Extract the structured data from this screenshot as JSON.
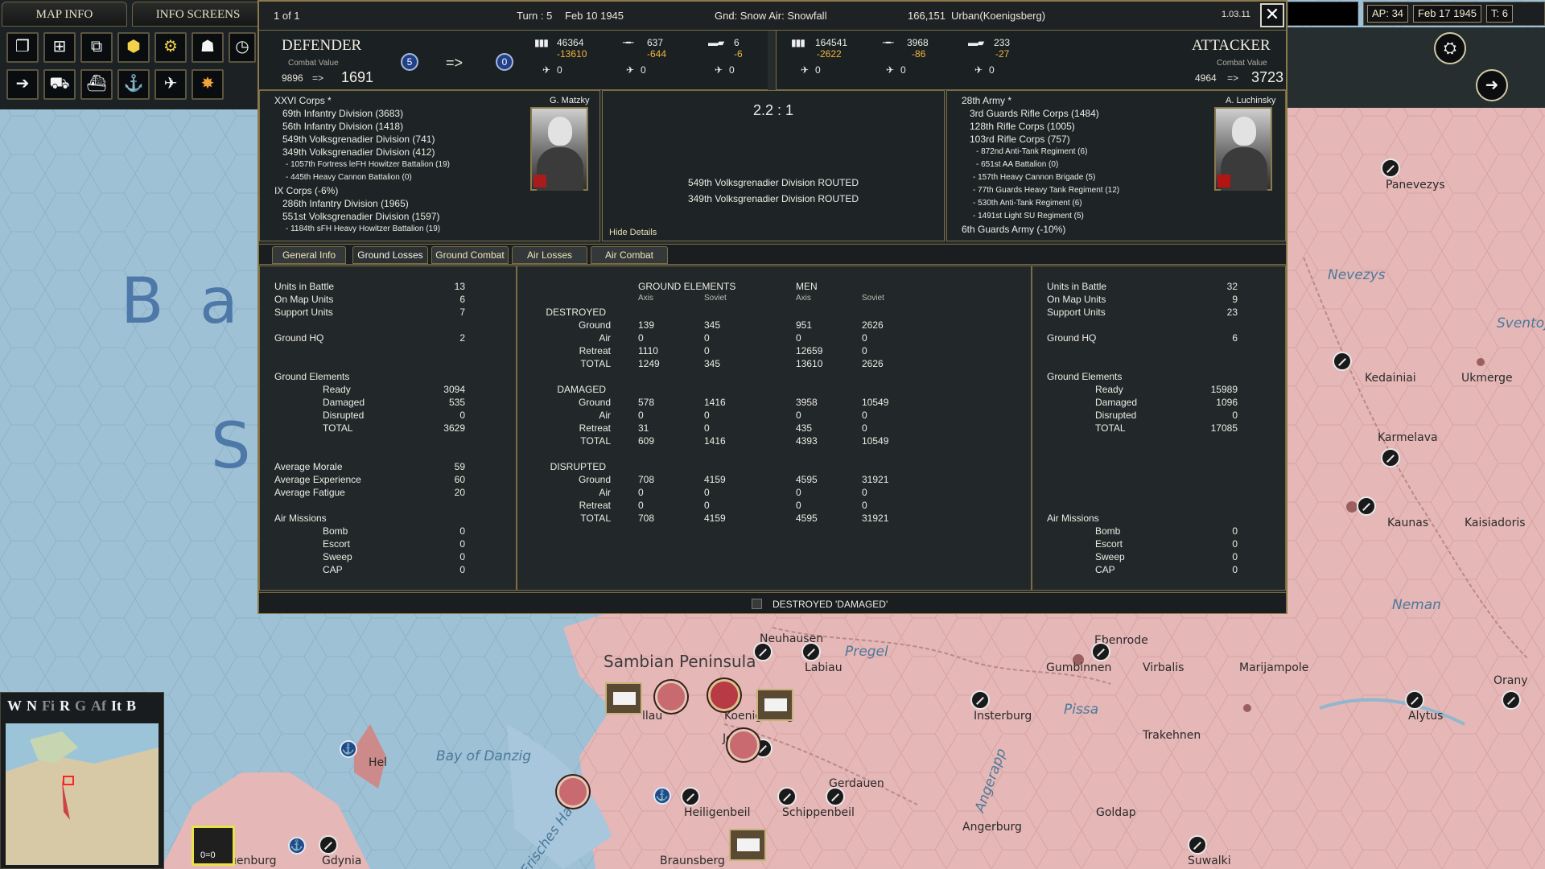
{
  "ui": {
    "map_info_tab": "MAP INFO",
    "info_screens_tab": "INFO SCREENS",
    "ap": "AP: 34",
    "date": "Feb 17 1945",
    "turn_short": "T: 6"
  },
  "dialog": {
    "page": "1 of 1",
    "turn": "Turn : 5",
    "date": "Feb 10 1945",
    "weather": "Gnd: Snow  Air: Snowfall",
    "coords": "166,151",
    "location": "Urban(Koenigsberg)",
    "version": "1.03.11",
    "ratio": "2.2 : 1",
    "hide_details": "Hide Details",
    "results": [
      "549th Volksgrenadier Division ROUTED",
      "349th Volksgrenadier Division ROUTED"
    ],
    "footer_text": "DESTROYED 'DAMAGED'",
    "arrow": "=>"
  },
  "defender": {
    "title": "DEFENDER",
    "cv_label": "Combat Value",
    "cv_from": "9896",
    "cv_arrow": "=>",
    "cv_to": "1691",
    "badge_a": "5",
    "badge_b": "0",
    "men": "46364",
    "men_loss": "-13610",
    "air": "637",
    "air_loss": "-644",
    "armor": "6",
    "armor_loss": "-6",
    "sub_a": "0",
    "sub_b": "0",
    "sub_c": "0",
    "commander": "G. Matzky",
    "oob": [
      {
        "t": "XXVI Corps *",
        "lvl": 0
      },
      {
        "t": "69th Infantry Division (3683)",
        "lvl": 1
      },
      {
        "t": "56th Infantry Division (1418)",
        "lvl": 1
      },
      {
        "t": "549th Volksgrenadier Division (741)",
        "lvl": 1
      },
      {
        "t": "349th Volksgrenadier Division (412)",
        "lvl": 1
      },
      {
        "t": "- 1057th Fortress leFH Howitzer Battalion (19)",
        "lvl": 2
      },
      {
        "t": "- 445th Heavy Cannon Battalion (0)",
        "lvl": 2
      },
      {
        "t": "IX Corps (-6%)",
        "lvl": 0
      },
      {
        "t": "286th Infantry Division (1965)",
        "lvl": 1
      },
      {
        "t": "551st Volksgrenadier Division (1597)",
        "lvl": 1
      },
      {
        "t": "- 1184th sFH Heavy Howitzer Battalion (19)",
        "lvl": 2
      }
    ]
  },
  "attacker": {
    "title": "ATTACKER",
    "cv_label": "Combat Value",
    "cv_from": "4964",
    "cv_arrow": "=>",
    "cv_to": "3723",
    "men": "164541",
    "men_loss": "-2622",
    "air": "3968",
    "air_loss": "-86",
    "armor": "233",
    "armor_loss": "-27",
    "sub_a": "0",
    "sub_b": "0",
    "sub_c": "0",
    "commander": "A. Luchinsky",
    "oob": [
      {
        "t": "28th Army *",
        "lvl": 0
      },
      {
        "t": "3rd Guards Rifle Corps (1484)",
        "lvl": 1
      },
      {
        "t": "128th Rifle Corps (1005)",
        "lvl": 1
      },
      {
        "t": "103rd Rifle Corps (757)",
        "lvl": 1
      },
      {
        "t": "- 872nd Anti-Tank Regiment (6)",
        "lvl": 3
      },
      {
        "t": "- 651st AA Battalion (0)",
        "lvl": 3
      },
      {
        "t": "- 157th Heavy Cannon Brigade (5)",
        "lvl": 2
      },
      {
        "t": "- 77th Guards Heavy Tank Regiment (12)",
        "lvl": 2
      },
      {
        "t": "- 530th Anti-Tank Regiment (6)",
        "lvl": 2
      },
      {
        "t": "- 1491st Light SU Regiment (5)",
        "lvl": 2
      },
      {
        "t": "6th Guards Army (-10%)",
        "lvl": 0
      }
    ]
  },
  "tabs": [
    "General Info",
    "Ground Losses",
    "Ground Combat",
    "Air Losses",
    "Air Combat"
  ],
  "left_stats": {
    "units_in_battle": [
      "Units in Battle",
      "13"
    ],
    "on_map": [
      "On Map Units",
      "6"
    ],
    "support": [
      "Support Units",
      "7"
    ],
    "hq": [
      "Ground HQ",
      "2"
    ],
    "ge_header": "Ground Elements",
    "ready": [
      "Ready",
      "3094"
    ],
    "damaged": [
      "Damaged",
      "535"
    ],
    "disrupted": [
      "Disrupted",
      "0"
    ],
    "total": [
      "TOTAL",
      "3629"
    ],
    "morale": [
      "Average Morale",
      "59"
    ],
    "experience": [
      "Average Experience",
      "60"
    ],
    "fatigue": [
      "Average Fatigue",
      "20"
    ],
    "air_header": "Air Missions",
    "bomb": [
      "Bomb",
      "0"
    ],
    "escort": [
      "Escort",
      "0"
    ],
    "sweep": [
      "Sweep",
      "0"
    ],
    "cap": [
      "CAP",
      "0"
    ]
  },
  "right_stats": {
    "units_in_battle": [
      "Units in Battle",
      "32"
    ],
    "on_map": [
      "On Map Units",
      "9"
    ],
    "support": [
      "Support Units",
      "23"
    ],
    "hq": [
      "Ground HQ",
      "6"
    ],
    "ge_header": "Ground Elements",
    "ready": [
      "Ready",
      "15989"
    ],
    "damaged": [
      "Damaged",
      "1096"
    ],
    "disrupted": [
      "Disrupted",
      "0"
    ],
    "total": [
      "TOTAL",
      "17085"
    ],
    "air_header": "Air Missions",
    "bomb": [
      "Bomb",
      "0"
    ],
    "escort": [
      "Escort",
      "0"
    ],
    "sweep": [
      "Sweep",
      "0"
    ],
    "cap": [
      "CAP",
      "0"
    ]
  },
  "losses": {
    "ge_header": "GROUND ELEMENTS",
    "men_header": "MEN",
    "axis": "Axis",
    "soviet": "Soviet",
    "sections": [
      {
        "title": "DESTROYED",
        "rows": [
          [
            "Ground",
            "139",
            "345",
            "951",
            "2626"
          ],
          [
            "Air",
            "0",
            "0",
            "0",
            "0"
          ],
          [
            "Retreat",
            "1110",
            "0",
            "12659",
            "0"
          ],
          [
            "TOTAL",
            "1249",
            "345",
            "13610",
            "2626"
          ]
        ]
      },
      {
        "title": "DAMAGED",
        "rows": [
          [
            "Ground",
            "578",
            "1416",
            "3958",
            "10549"
          ],
          [
            "Air",
            "0",
            "0",
            "0",
            "0"
          ],
          [
            "Retreat",
            "31",
            "0",
            "435",
            "0"
          ],
          [
            "TOTAL",
            "609",
            "1416",
            "4393",
            "10549"
          ]
        ]
      },
      {
        "title": "DISRUPTED",
        "rows": [
          [
            "Ground",
            "708",
            "4159",
            "4595",
            "31921"
          ],
          [
            "Air",
            "0",
            "0",
            "0",
            "0"
          ],
          [
            "Retreat",
            "0",
            "0",
            "0",
            "0"
          ],
          [
            "TOTAL",
            "708",
            "4159",
            "4595",
            "31921"
          ]
        ]
      }
    ]
  },
  "map": {
    "cities": [
      "Panevezys",
      "Kedainiai",
      "Ukmerge",
      "Karmelava",
      "Kaunas",
      "Kaisiadoris",
      "Neuhausen",
      "Labiau",
      "Gumbinnen",
      "Virbalis",
      "Marijampole",
      "Ebenrode",
      "Insterburg",
      "Trakehnen",
      "Alytus",
      "Orany",
      "Gerdauen",
      "Heiligenbeil",
      "Schippenbeil",
      "Goldap",
      "Angerburg",
      "Braunsberg",
      "Suwalki",
      "Gdynia",
      "Hel",
      "uenburg",
      "llau",
      "Jesau",
      "Koenigsberg"
    ],
    "regions": [
      "Sambian Peninsula"
    ],
    "waters": [
      "Nevezys",
      "Sventoji",
      "Neman",
      "Pregel",
      "Pissa",
      "Angerapp",
      "Bay of Danzig",
      "Frisches Haff"
    ],
    "sea": [
      "B",
      "a",
      "S"
    ],
    "minimap_filters": [
      "W",
      "N",
      "Fi",
      "R",
      "G",
      "Af",
      "It",
      "B"
    ],
    "indicator": "0=0"
  },
  "colors": {
    "accent": "#8a7a4a",
    "loss": "#f0b640",
    "land": "#e6b7b7",
    "water": "#a9c7dc",
    "sea": "#9ec1d6"
  }
}
